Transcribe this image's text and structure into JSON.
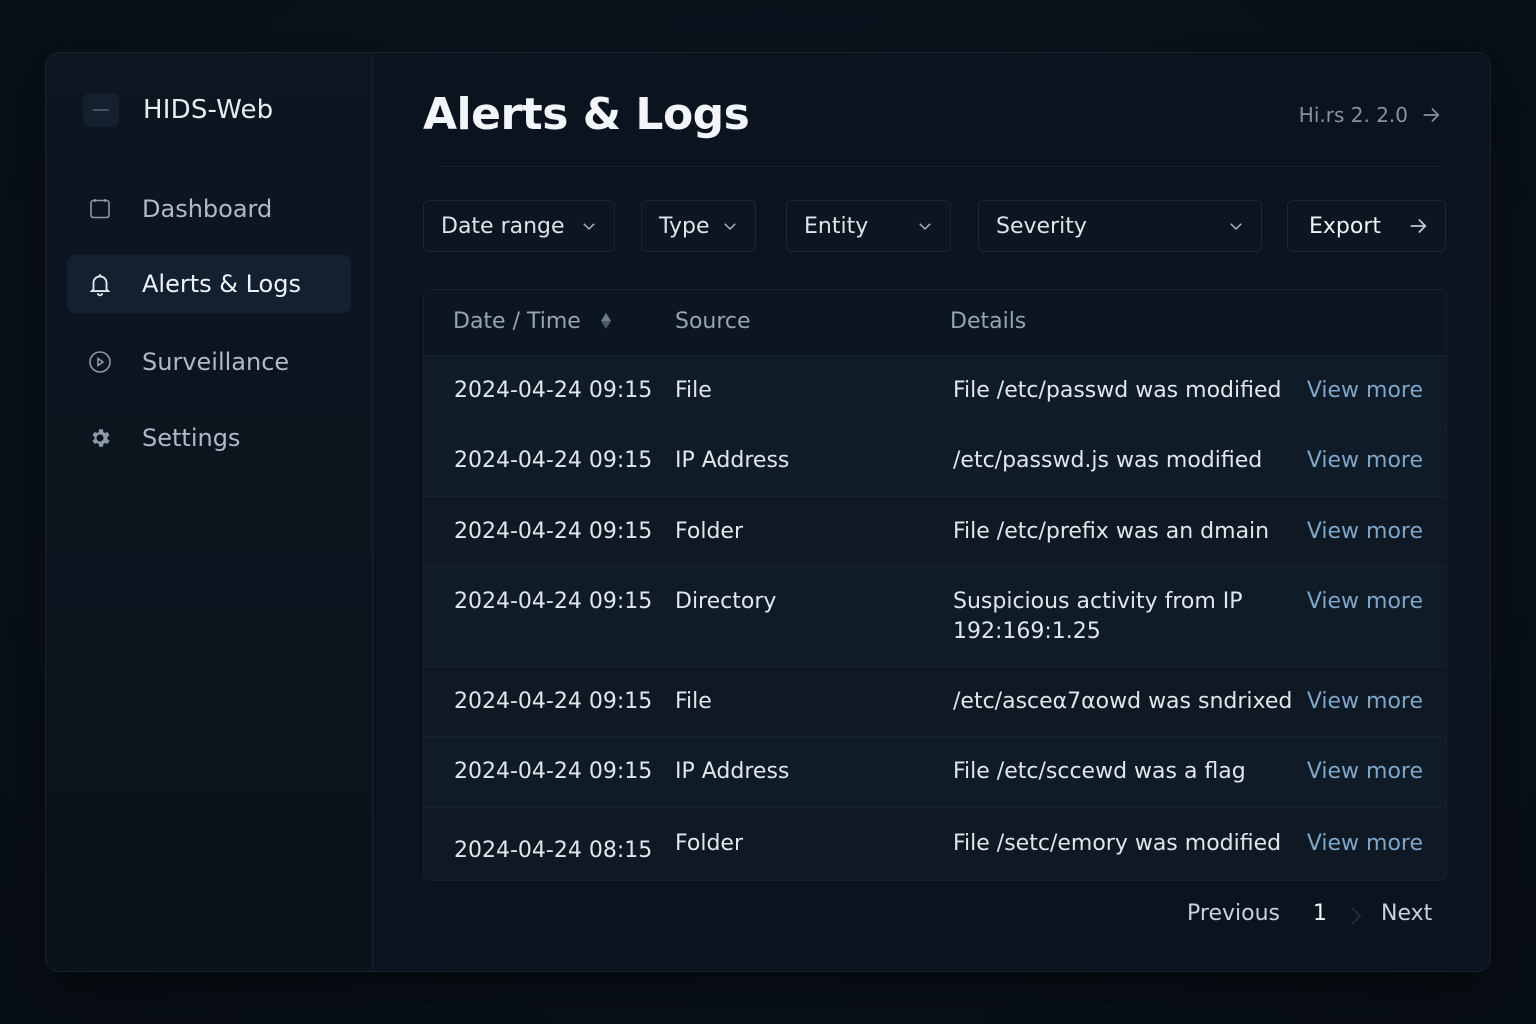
{
  "app": {
    "name": "HIDS-Web"
  },
  "sidebar": {
    "items": [
      {
        "label": "Dashboard",
        "icon": "calendar-icon",
        "active": false
      },
      {
        "label": "Alerts & Logs",
        "icon": "bell-icon",
        "active": true
      },
      {
        "label": "Surveillance",
        "icon": "play-circle-icon",
        "active": false
      },
      {
        "label": "Settings",
        "icon": "gear-icon",
        "active": false
      }
    ]
  },
  "header": {
    "title": "Alerts & Logs",
    "link_label": "Hi.rs 2. 2.0"
  },
  "filters": {
    "date_range": "Date range",
    "type": "Type",
    "entity": "Entity",
    "severity": "Severity",
    "export": "Export"
  },
  "table": {
    "columns": [
      "Date / Time",
      "Source",
      "Details"
    ],
    "rows": [
      {
        "datetime": "2024-04-24 09:15",
        "source": "File",
        "details": "File /etc/passwd was modified",
        "action": "View more"
      },
      {
        "datetime": "2024-04-24 09:15",
        "source": "IP Address",
        "details": "/etc/passwd.js was modified",
        "action": "View more"
      },
      {
        "datetime": "2024-04-24 09:15",
        "source": "Folder",
        "details": "File /etc/prefix was an dmain",
        "action": "View more"
      },
      {
        "datetime": "2024-04-24 09:15",
        "source": "Directory",
        "details": "Suspicious activity from IP",
        "details_line2": "192:169:1.25",
        "action": "View more"
      },
      {
        "datetime": "2024-04-24 09:15",
        "source": "File",
        "details": "/etc/asceα7αowd was sndrixed",
        "action": "View more"
      },
      {
        "datetime": "2024-04-24 09:15",
        "source": "IP Address",
        "details": "File /etc/sccewd was a flag",
        "action": "View more"
      },
      {
        "datetime": "2024-04-24 08:15",
        "source": "Folder",
        "details": "File /setc/emory was modified",
        "action": "View more"
      }
    ]
  },
  "pagination": {
    "previous": "Previous",
    "current": "1",
    "next": "Next"
  },
  "colors": {
    "background": "#0a121b",
    "accent_link": "#7fa6c9",
    "active_nav": "#132030"
  }
}
